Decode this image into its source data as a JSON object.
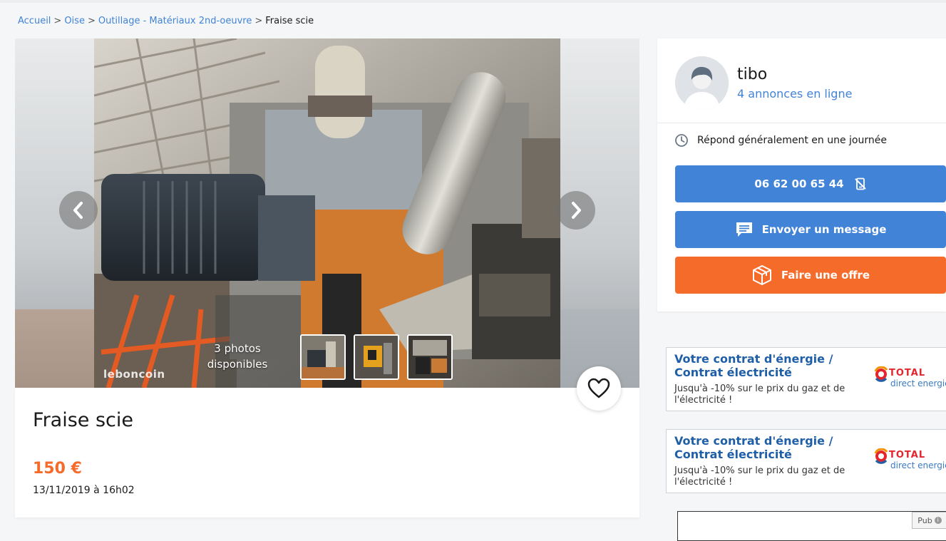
{
  "breadcrumb": {
    "items": [
      "Accueil",
      "Oise",
      "Outillage - Matériaux 2nd-oeuvre"
    ],
    "current": "Fraise scie",
    "separator": ">"
  },
  "gallery": {
    "watermark": "leboncoin",
    "photo_count_line1": "3 photos",
    "photo_count_line2": "disponibles",
    "thumbnail_count": 3
  },
  "ad": {
    "title": "Fraise scie",
    "price": "150 €",
    "date": "13/11/2019 à 16h02"
  },
  "seller": {
    "name": "tibo",
    "listings": "4 annonces en ligne",
    "response_time": "Répond généralement en une journée",
    "phone_button": "06 62 00 65 44",
    "message_button": "Envoyer un message",
    "offer_button": "Faire une offre"
  },
  "ads": [
    {
      "headline_line1": "Votre contrat d'énergie /",
      "headline_line2": "Contrat électricité",
      "body": "Jusqu'à -10% sur le prix du gaz et de l'électricité !",
      "logo_text": "TOTAL",
      "logo_sub": "direct energie"
    },
    {
      "headline_line1": "Votre contrat d'énergie /",
      "headline_line2": "Contrat électricité",
      "body": "Jusqu'à -10% sur le prix du gaz et de l'électricité !",
      "logo_text": "TOTAL",
      "logo_sub": "direct energie"
    }
  ],
  "pub_label": "Pub",
  "colors": {
    "accent_blue": "#4183d7",
    "accent_orange": "#f56b2a",
    "ad_blue": "#1f5fa8",
    "total_red": "#e3262e"
  },
  "icons": {
    "prev": "chevron-left-icon",
    "next": "chevron-right-icon",
    "favorite": "heart-icon",
    "clock": "clock-icon",
    "phone_hidden": "phone-slash-icon",
    "message": "chat-bubble-icon",
    "offer": "package-icon"
  }
}
